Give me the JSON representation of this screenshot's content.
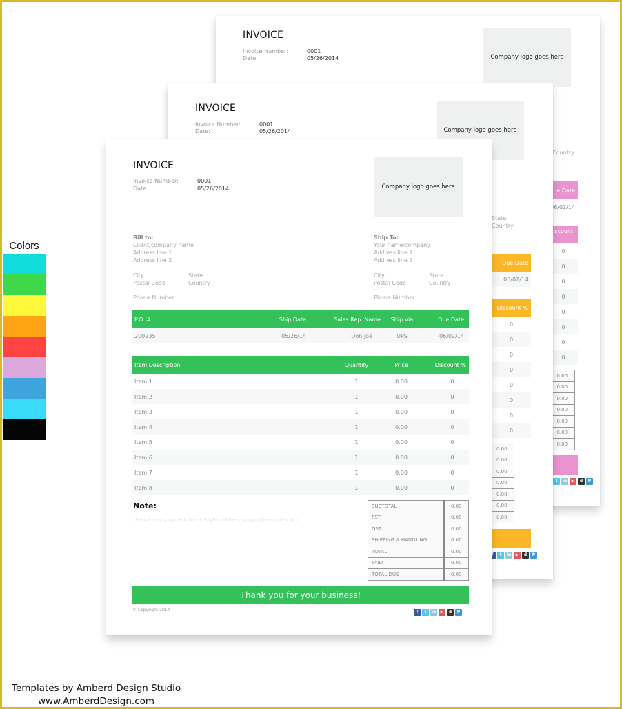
{
  "palette": {
    "title": "Colors",
    "swatches": [
      "#10dcdc",
      "#3ed94a",
      "#fff73a",
      "#ffa414",
      "#ff4242",
      "#dba8dc",
      "#3ea4dc",
      "#38dcfa",
      "#050505"
    ]
  },
  "credits": {
    "line1": "Templates by Amberd Design Studio",
    "line2": "www.AmberdDesign.com"
  },
  "invoice": {
    "title": "INVOICE",
    "number_label": "Invoice Number:",
    "number": "0001",
    "date_label": "Date:",
    "date": "05/26/2014",
    "logo_placeholder": "Company logo goes here",
    "bill_to": {
      "heading": "Bill to:",
      "name": "Client/company name",
      "address1": "Address line 1",
      "address2": "Address line 2",
      "city": "City",
      "state": "State",
      "postal": "Postal Code",
      "country": "Country",
      "phone": "Phone Number"
    },
    "ship_to": {
      "heading": "Ship To:",
      "name": "Your name/company",
      "address1": "Address line 1",
      "address2": "Address line 2",
      "city": "City",
      "state": "State",
      "postal": "Postal Code",
      "country": "Country",
      "phone": "Phone Number"
    },
    "order": {
      "headers": [
        "P.O. #",
        "Ship Date",
        "Sales Rep. Name",
        "Ship Via",
        "Due Date"
      ],
      "row": [
        "200235",
        "05/26/14",
        "Don Joe",
        "UPS",
        "06/02/14"
      ]
    },
    "items": {
      "headers": [
        "Item Description",
        "Quantity",
        "Price",
        "Discount %"
      ],
      "rows": [
        [
          "Item 1",
          "1",
          "0.00",
          "0"
        ],
        [
          "Item 2",
          "1",
          "0.00",
          "0"
        ],
        [
          "Item 3",
          "1",
          "0.00",
          "0"
        ],
        [
          "Item 4",
          "1",
          "0.00",
          "0"
        ],
        [
          "Item 5",
          "1",
          "0.00",
          "0"
        ],
        [
          "Item 6",
          "1",
          "0.00",
          "0"
        ],
        [
          "Item 7",
          "1",
          "0.00",
          "0"
        ],
        [
          "Item 8",
          "1",
          "0.00",
          "0"
        ]
      ]
    },
    "note_label": "Note:",
    "note_text": "Please send payment to my PayPal address: paypal@example.com",
    "totals": [
      {
        "label": "SUBTOTAL",
        "value": "0.00"
      },
      {
        "label": "PST",
        "value": "0.00"
      },
      {
        "label": "GST",
        "value": "0.00"
      },
      {
        "label": "SHIPPING & HANDLING",
        "value": "0.00"
      },
      {
        "label": "TOTAL",
        "value": "0.00"
      },
      {
        "label": "PAID",
        "value": "0.00"
      },
      {
        "label": "TOTAL DUE",
        "value": "0.00"
      }
    ],
    "thanks": "Thank you for your business!",
    "copyright": "© Copyright 2014",
    "socials": [
      {
        "icon": "facebook-icon",
        "glyph": "f",
        "color": "#3b5998"
      },
      {
        "icon": "twitter-icon",
        "glyph": "t",
        "color": "#55c5ef"
      },
      {
        "icon": "linkedin-icon",
        "glyph": "in",
        "color": "#8fc9de"
      },
      {
        "icon": "youtube-icon",
        "glyph": "▶",
        "color": "#e05a5a"
      },
      {
        "icon": "digg-icon",
        "glyph": "d",
        "color": "#333333"
      },
      {
        "icon": "paypal-icon",
        "glyph": "P",
        "color": "#3a9ad9"
      }
    ]
  },
  "accents": {
    "front": "#35c15a",
    "middle": "#fbb726",
    "back": "#ec94cf"
  }
}
